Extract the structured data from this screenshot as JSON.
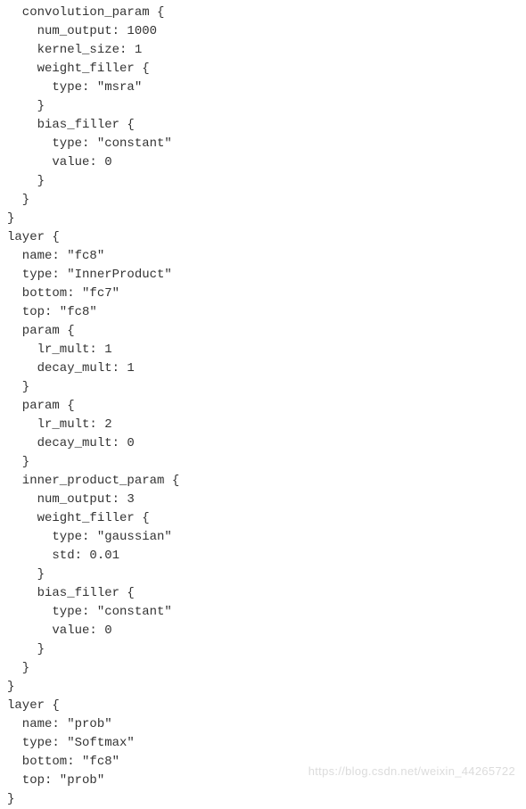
{
  "code": "  convolution_param {\n    num_output: 1000\n    kernel_size: 1\n    weight_filler {\n      type: \"msra\"\n    }\n    bias_filler {\n      type: \"constant\"\n      value: 0\n    }\n  }\n}\nlayer {\n  name: \"fc8\"\n  type: \"InnerProduct\"\n  bottom: \"fc7\"\n  top: \"fc8\"\n  param {\n    lr_mult: 1\n    decay_mult: 1\n  }\n  param {\n    lr_mult: 2\n    decay_mult: 0\n  }\n  inner_product_param {\n    num_output: 3\n    weight_filler {\n      type: \"gaussian\"\n      std: 0.01\n    }\n    bias_filler {\n      type: \"constant\"\n      value: 0\n    }\n  }\n}\nlayer {\n  name: \"prob\"\n  type: \"Softmax\"\n  bottom: \"fc8\"\n  top: \"prob\"\n}",
  "watermark": "https://blog.csdn.net/weixin_44265722"
}
